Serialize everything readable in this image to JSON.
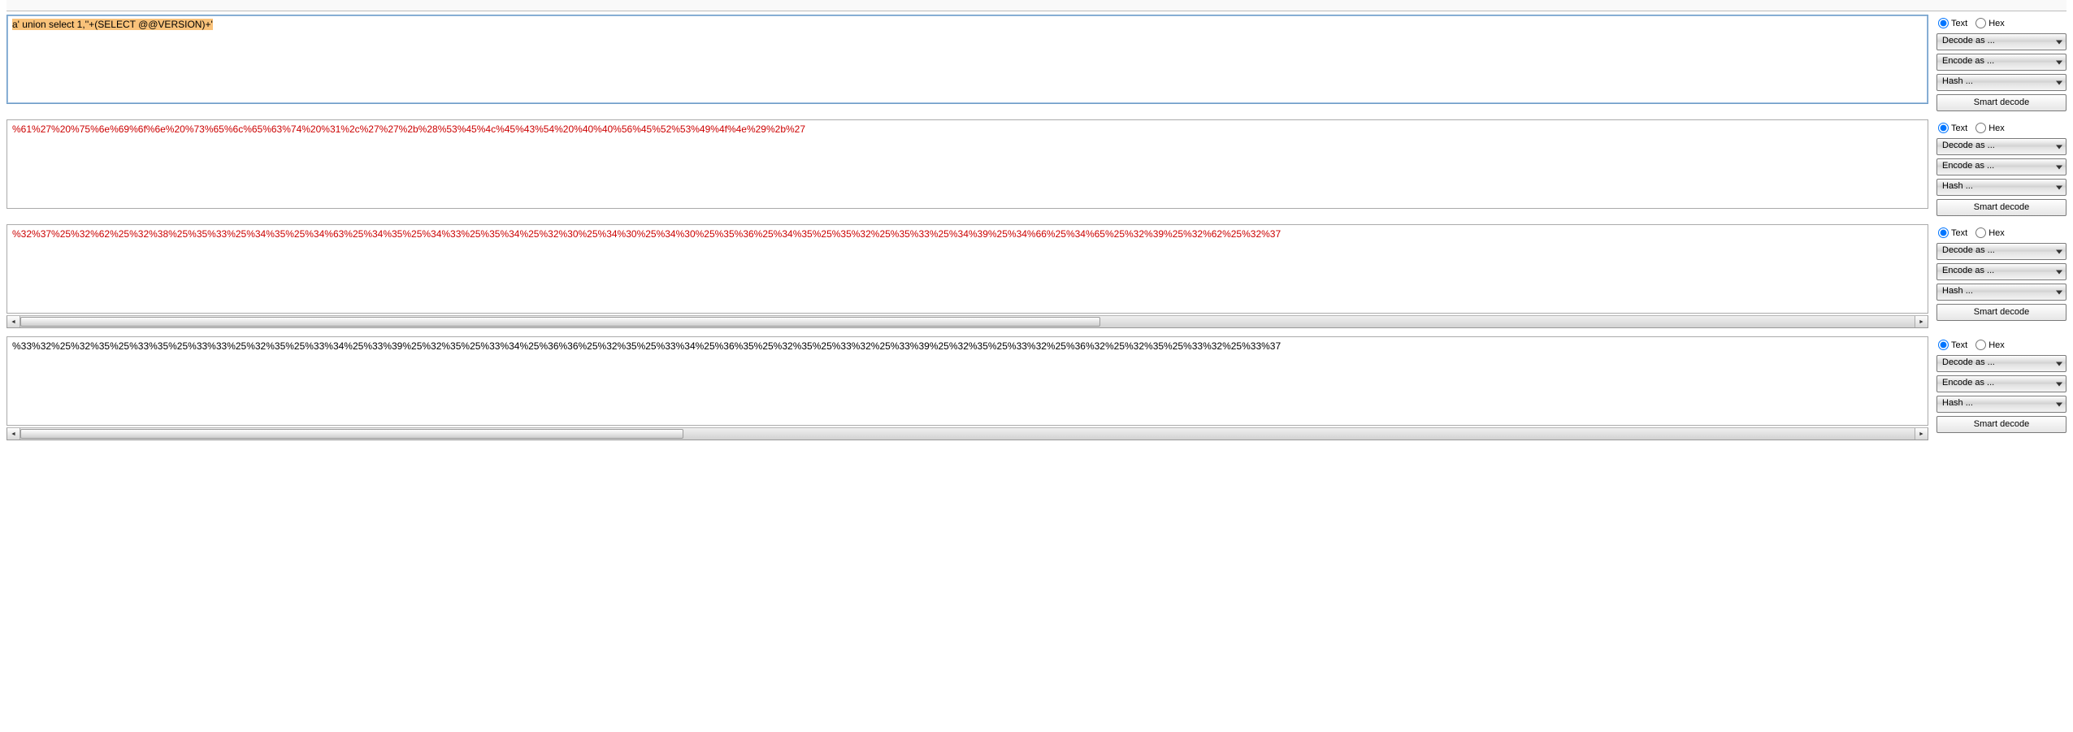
{
  "panels": [
    {
      "content": "a' union select 1,''+(SELECT @@VERSION)+'",
      "highlighted": true,
      "textClass": "black-text",
      "hasScrollbar": false,
      "selected": true
    },
    {
      "content": "%61%27%20%75%6e%69%6f%6e%20%73%65%6c%65%63%74%20%31%2c%27%27%2b%28%53%45%4c%45%43%54%20%40%40%56%45%52%53%49%4f%4e%29%2b%27",
      "highlighted": false,
      "textClass": "red-text",
      "hasScrollbar": false,
      "selected": false
    },
    {
      "content": "%32%37%25%32%62%25%32%38%25%35%33%25%34%35%25%34%63%25%34%35%25%34%33%25%35%34%25%32%30%25%34%30%25%34%30%25%35%36%25%34%35%25%35%32%25%35%33%25%34%39%25%34%66%25%34%65%25%32%39%25%32%62%25%32%37",
      "highlighted": false,
      "textClass": "red-text",
      "hasScrollbar": true,
      "thumbWidth": "57%",
      "selected": false
    },
    {
      "content": "%33%32%25%32%35%25%33%35%25%33%33%25%32%35%25%33%34%25%33%39%25%32%35%25%33%34%25%36%36%25%32%35%25%33%34%25%36%35%25%32%35%25%33%32%25%33%39%25%32%35%25%33%32%25%36%32%25%32%35%25%33%32%25%33%37",
      "highlighted": false,
      "textClass": "black-text",
      "hasScrollbar": true,
      "thumbWidth": "35%",
      "selected": false
    }
  ],
  "controls": {
    "radioText": "Text",
    "radioHex": "Hex",
    "decodeLabel": "Decode as ...",
    "encodeLabel": "Encode as ...",
    "hashLabel": "Hash ...",
    "smartDecode": "Smart decode"
  }
}
